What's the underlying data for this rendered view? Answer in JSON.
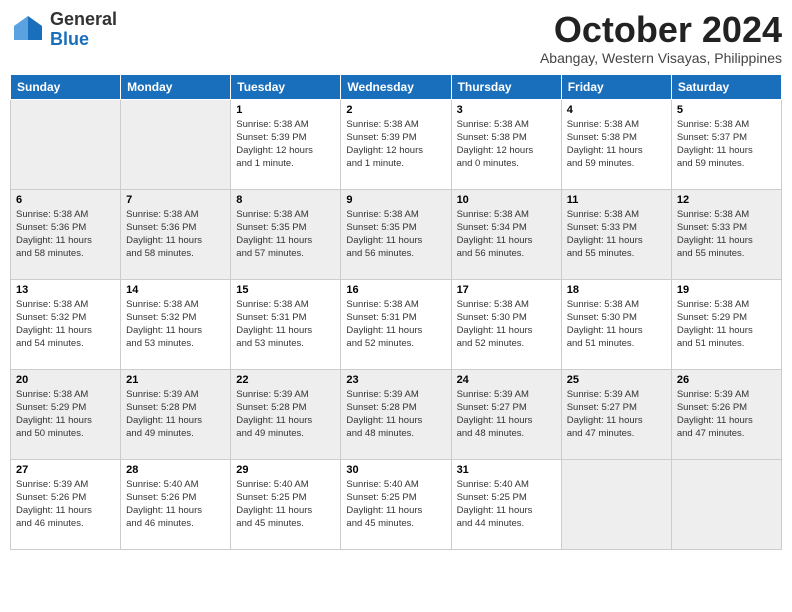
{
  "header": {
    "logo_general": "General",
    "logo_blue": "Blue",
    "month": "October 2024",
    "location": "Abangay, Western Visayas, Philippines"
  },
  "weekdays": [
    "Sunday",
    "Monday",
    "Tuesday",
    "Wednesday",
    "Thursday",
    "Friday",
    "Saturday"
  ],
  "weeks": [
    [
      {
        "day": "",
        "info": ""
      },
      {
        "day": "",
        "info": ""
      },
      {
        "day": "1",
        "info": "Sunrise: 5:38 AM\nSunset: 5:39 PM\nDaylight: 12 hours\nand 1 minute."
      },
      {
        "day": "2",
        "info": "Sunrise: 5:38 AM\nSunset: 5:39 PM\nDaylight: 12 hours\nand 1 minute."
      },
      {
        "day": "3",
        "info": "Sunrise: 5:38 AM\nSunset: 5:38 PM\nDaylight: 12 hours\nand 0 minutes."
      },
      {
        "day": "4",
        "info": "Sunrise: 5:38 AM\nSunset: 5:38 PM\nDaylight: 11 hours\nand 59 minutes."
      },
      {
        "day": "5",
        "info": "Sunrise: 5:38 AM\nSunset: 5:37 PM\nDaylight: 11 hours\nand 59 minutes."
      }
    ],
    [
      {
        "day": "6",
        "info": "Sunrise: 5:38 AM\nSunset: 5:36 PM\nDaylight: 11 hours\nand 58 minutes."
      },
      {
        "day": "7",
        "info": "Sunrise: 5:38 AM\nSunset: 5:36 PM\nDaylight: 11 hours\nand 58 minutes."
      },
      {
        "day": "8",
        "info": "Sunrise: 5:38 AM\nSunset: 5:35 PM\nDaylight: 11 hours\nand 57 minutes."
      },
      {
        "day": "9",
        "info": "Sunrise: 5:38 AM\nSunset: 5:35 PM\nDaylight: 11 hours\nand 56 minutes."
      },
      {
        "day": "10",
        "info": "Sunrise: 5:38 AM\nSunset: 5:34 PM\nDaylight: 11 hours\nand 56 minutes."
      },
      {
        "day": "11",
        "info": "Sunrise: 5:38 AM\nSunset: 5:33 PM\nDaylight: 11 hours\nand 55 minutes."
      },
      {
        "day": "12",
        "info": "Sunrise: 5:38 AM\nSunset: 5:33 PM\nDaylight: 11 hours\nand 55 minutes."
      }
    ],
    [
      {
        "day": "13",
        "info": "Sunrise: 5:38 AM\nSunset: 5:32 PM\nDaylight: 11 hours\nand 54 minutes."
      },
      {
        "day": "14",
        "info": "Sunrise: 5:38 AM\nSunset: 5:32 PM\nDaylight: 11 hours\nand 53 minutes."
      },
      {
        "day": "15",
        "info": "Sunrise: 5:38 AM\nSunset: 5:31 PM\nDaylight: 11 hours\nand 53 minutes."
      },
      {
        "day": "16",
        "info": "Sunrise: 5:38 AM\nSunset: 5:31 PM\nDaylight: 11 hours\nand 52 minutes."
      },
      {
        "day": "17",
        "info": "Sunrise: 5:38 AM\nSunset: 5:30 PM\nDaylight: 11 hours\nand 52 minutes."
      },
      {
        "day": "18",
        "info": "Sunrise: 5:38 AM\nSunset: 5:30 PM\nDaylight: 11 hours\nand 51 minutes."
      },
      {
        "day": "19",
        "info": "Sunrise: 5:38 AM\nSunset: 5:29 PM\nDaylight: 11 hours\nand 51 minutes."
      }
    ],
    [
      {
        "day": "20",
        "info": "Sunrise: 5:38 AM\nSunset: 5:29 PM\nDaylight: 11 hours\nand 50 minutes."
      },
      {
        "day": "21",
        "info": "Sunrise: 5:39 AM\nSunset: 5:28 PM\nDaylight: 11 hours\nand 49 minutes."
      },
      {
        "day": "22",
        "info": "Sunrise: 5:39 AM\nSunset: 5:28 PM\nDaylight: 11 hours\nand 49 minutes."
      },
      {
        "day": "23",
        "info": "Sunrise: 5:39 AM\nSunset: 5:28 PM\nDaylight: 11 hours\nand 48 minutes."
      },
      {
        "day": "24",
        "info": "Sunrise: 5:39 AM\nSunset: 5:27 PM\nDaylight: 11 hours\nand 48 minutes."
      },
      {
        "day": "25",
        "info": "Sunrise: 5:39 AM\nSunset: 5:27 PM\nDaylight: 11 hours\nand 47 minutes."
      },
      {
        "day": "26",
        "info": "Sunrise: 5:39 AM\nSunset: 5:26 PM\nDaylight: 11 hours\nand 47 minutes."
      }
    ],
    [
      {
        "day": "27",
        "info": "Sunrise: 5:39 AM\nSunset: 5:26 PM\nDaylight: 11 hours\nand 46 minutes."
      },
      {
        "day": "28",
        "info": "Sunrise: 5:40 AM\nSunset: 5:26 PM\nDaylight: 11 hours\nand 46 minutes."
      },
      {
        "day": "29",
        "info": "Sunrise: 5:40 AM\nSunset: 5:25 PM\nDaylight: 11 hours\nand 45 minutes."
      },
      {
        "day": "30",
        "info": "Sunrise: 5:40 AM\nSunset: 5:25 PM\nDaylight: 11 hours\nand 45 minutes."
      },
      {
        "day": "31",
        "info": "Sunrise: 5:40 AM\nSunset: 5:25 PM\nDaylight: 11 hours\nand 44 minutes."
      },
      {
        "day": "",
        "info": ""
      },
      {
        "day": "",
        "info": ""
      }
    ]
  ]
}
